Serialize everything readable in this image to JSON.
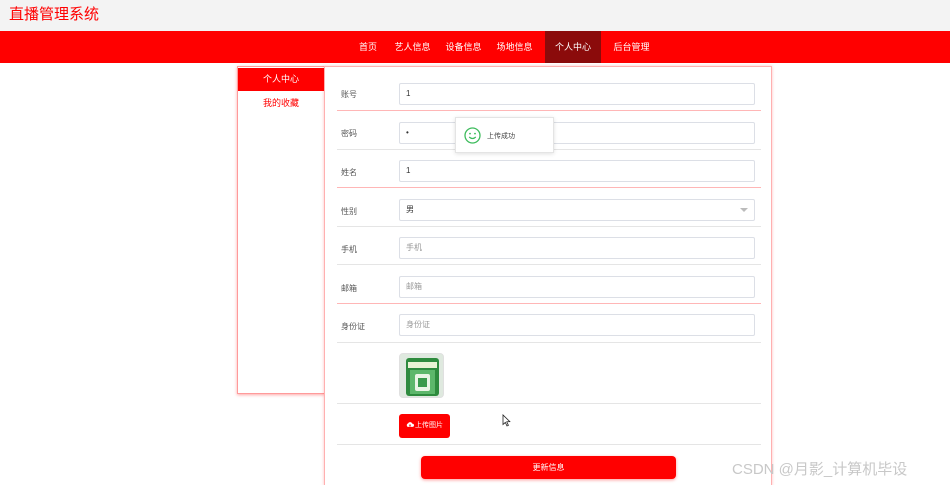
{
  "app": {
    "title": "直播管理系统"
  },
  "nav": {
    "items": [
      {
        "label": "首页",
        "active": false
      },
      {
        "label": "艺人信息",
        "active": false
      },
      {
        "label": "设备信息",
        "active": false
      },
      {
        "label": "场地信息",
        "active": false
      },
      {
        "label": "个人中心",
        "active": true
      },
      {
        "label": "后台管理",
        "active": false
      }
    ]
  },
  "sidebar": {
    "items": [
      {
        "label": "个人中心",
        "active": true
      },
      {
        "label": "我的收藏",
        "active": false
      }
    ]
  },
  "form": {
    "account": {
      "label": "账号",
      "value": "1"
    },
    "password": {
      "label": "密码",
      "value": "•"
    },
    "name": {
      "label": "姓名",
      "value": "1"
    },
    "gender": {
      "label": "性别",
      "value": "男"
    },
    "phone": {
      "label": "手机",
      "placeholder": "手机"
    },
    "email": {
      "label": "邮箱",
      "placeholder": "邮箱"
    },
    "id_card": {
      "label": "身份证",
      "placeholder": "身份证"
    },
    "upload_label": "上传图片",
    "submit_label": "更新信息"
  },
  "toast": {
    "message": "上传成功",
    "icon": "smile-icon"
  },
  "watermark": "CSDN @月影_计算机毕设",
  "colors": {
    "brand": "#ff0000",
    "nav_active": "#8b0b0b",
    "toast_icon": "#3dbb5c"
  }
}
